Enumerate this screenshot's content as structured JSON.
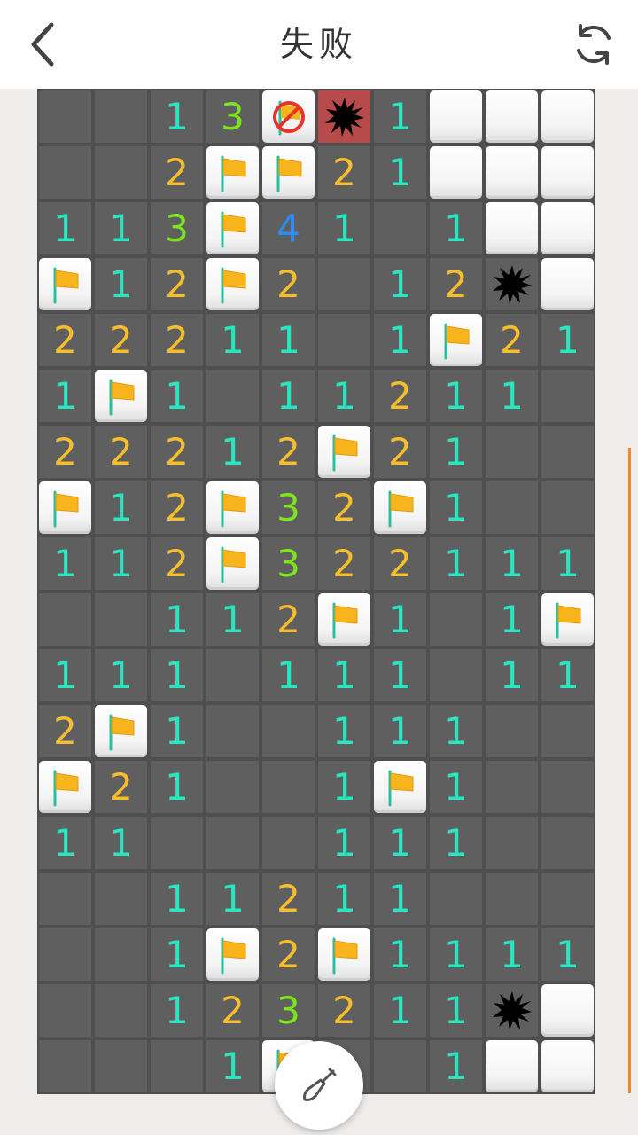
{
  "header": {
    "title": "失败",
    "back_icon": "chevron-left-icon",
    "refresh_icon": "refresh-icon"
  },
  "board": {
    "rows": 18,
    "cols": 10,
    "legend": "1-9 = number, 0 = empty revealed, C = covered, F = flag, M = mine, X = exploded mine, W = wrong flag",
    "grid": [
      [
        "0",
        "0",
        "1",
        "3",
        "W",
        "X",
        "1",
        "C",
        "C",
        "C"
      ],
      [
        "0",
        "0",
        "2",
        "F",
        "F",
        "2",
        "1",
        "C",
        "C",
        "C"
      ],
      [
        "1",
        "1",
        "3",
        "F",
        "4",
        "1",
        "0",
        "1",
        "C",
        "C"
      ],
      [
        "F",
        "1",
        "2",
        "F",
        "2",
        "0",
        "1",
        "2",
        "M",
        "C"
      ],
      [
        "2",
        "2",
        "2",
        "1",
        "1",
        "0",
        "1",
        "F",
        "2",
        "1"
      ],
      [
        "1",
        "F",
        "1",
        "0",
        "1",
        "1",
        "2",
        "1",
        "1",
        "0"
      ],
      [
        "2",
        "2",
        "2",
        "1",
        "2",
        "F",
        "2",
        "1",
        "0",
        "0"
      ],
      [
        "F",
        "1",
        "2",
        "F",
        "3",
        "2",
        "F",
        "1",
        "0",
        "0"
      ],
      [
        "1",
        "1",
        "2",
        "F",
        "3",
        "2",
        "2",
        "1",
        "1",
        "1"
      ],
      [
        "0",
        "0",
        "1",
        "1",
        "2",
        "F",
        "1",
        "0",
        "1",
        "F"
      ],
      [
        "1",
        "1",
        "1",
        "0",
        "1",
        "1",
        "1",
        "0",
        "1",
        "1"
      ],
      [
        "2",
        "F",
        "1",
        "0",
        "0",
        "1",
        "1",
        "1",
        "0",
        "0"
      ],
      [
        "F",
        "2",
        "1",
        "0",
        "0",
        "1",
        "F",
        "1",
        "0",
        "0"
      ],
      [
        "1",
        "1",
        "0",
        "0",
        "0",
        "1",
        "1",
        "1",
        "0",
        "0"
      ],
      [
        "0",
        "0",
        "1",
        "1",
        "2",
        "1",
        "1",
        "0",
        "0",
        "0"
      ],
      [
        "0",
        "0",
        "1",
        "F",
        "2",
        "F",
        "1",
        "1",
        "1",
        "1"
      ],
      [
        "0",
        "0",
        "1",
        "2",
        "3",
        "2",
        "1",
        "1",
        "M",
        "C"
      ],
      [
        "0",
        "0",
        "0",
        "1",
        "F",
        "0",
        "0",
        "1",
        "C",
        "C"
      ]
    ]
  },
  "colors": {
    "n1": "#29e5c0",
    "n2": "#f6be2c",
    "n3": "#7be61c",
    "n4": "#2a8cf5",
    "board_bg": "#4f4f4f",
    "revealed_bg": "#5f5f5f",
    "exploded_bg": "#b74a4a",
    "progress": "#ef8a2b"
  },
  "fab": {
    "icon": "shovel-icon"
  }
}
